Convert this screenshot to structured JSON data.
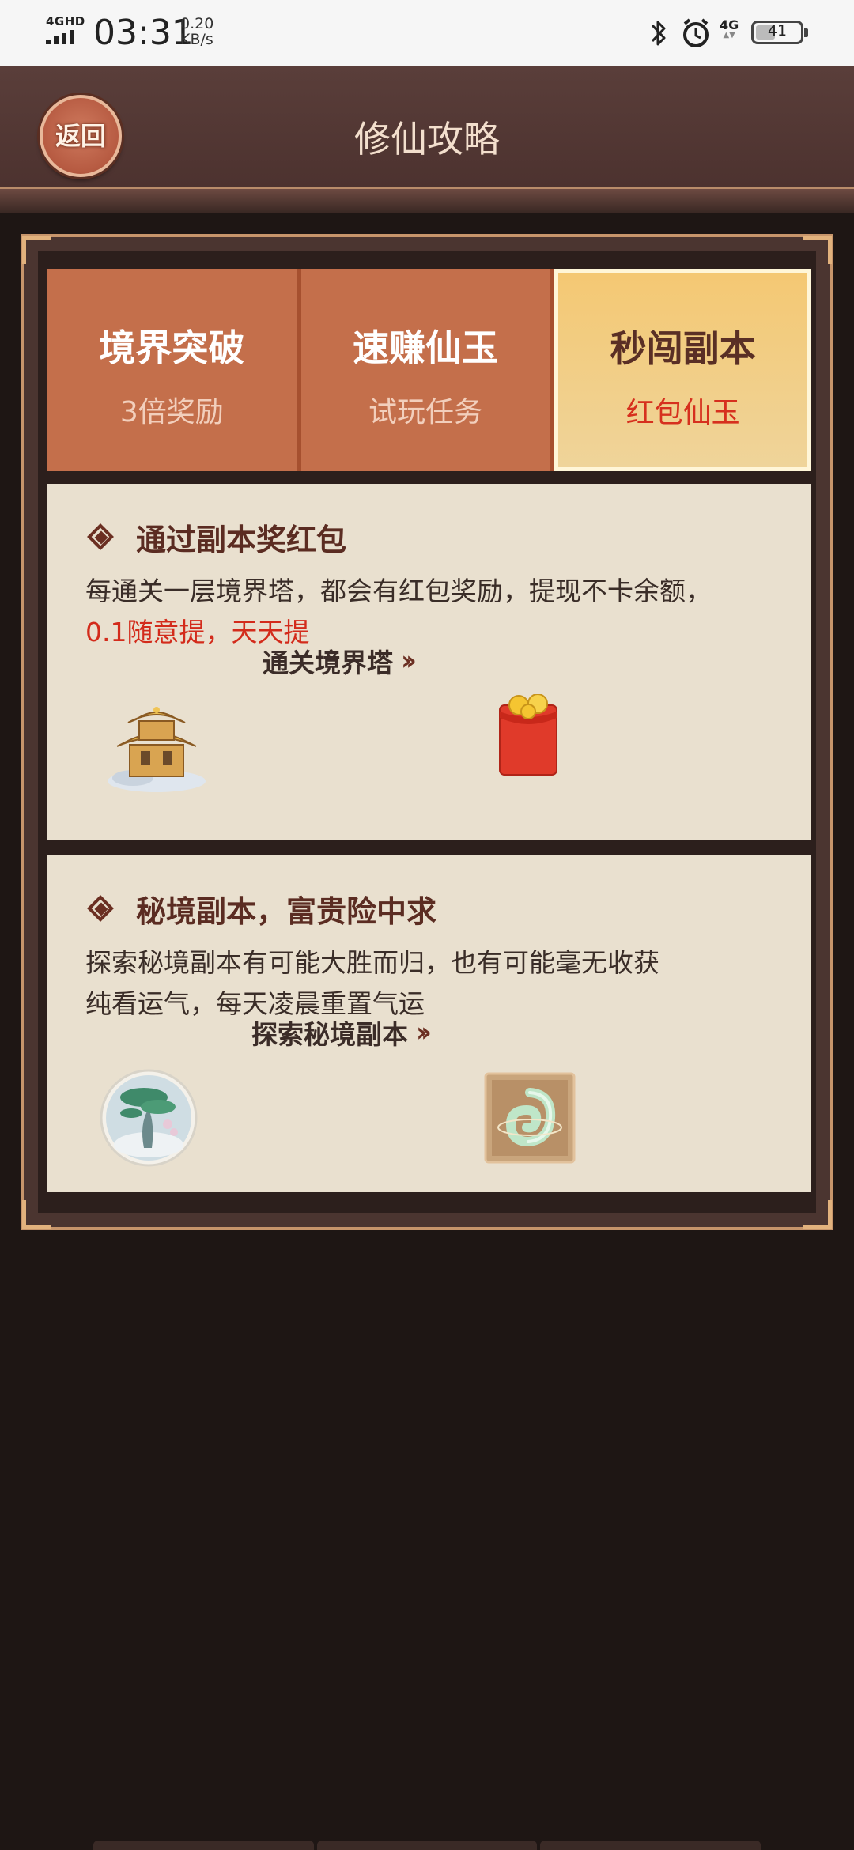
{
  "status_bar": {
    "network": "4GHD",
    "time": "03:31",
    "speed_value": "0.20",
    "speed_unit": "KB/s",
    "cell": "4G",
    "battery": "41"
  },
  "header": {
    "back_label": "返回",
    "title": "修仙攻略"
  },
  "tabs": [
    {
      "title": "境界突破",
      "subtitle": "3倍奖励",
      "active": false
    },
    {
      "title": "速赚仙玉",
      "subtitle": "试玩任务",
      "active": false
    },
    {
      "title": "秒闯副本",
      "subtitle": "红包仙玉",
      "active": true
    }
  ],
  "cards": [
    {
      "title": "通过副本奖红包",
      "desc_line1": "每通关一层境界塔，都会有红包奖励，提现不卡余额，",
      "desc_highlight": "0.1随意提，天天提",
      "link_label": "通关境界塔"
    },
    {
      "title": "秘境副本，富贵险中求",
      "desc_line1": "探索秘境副本有可能大胜而归，也有可能毫无收获",
      "desc_line2": "纯看运气，每天凌晨重置气运",
      "link_label": "探索秘境副本"
    }
  ],
  "colors": {
    "background": "#1e1614",
    "tab": "#c46f4b",
    "tab_active": "#f4c873",
    "card": "#e9e0cf",
    "highlight": "#d32b1b"
  },
  "icons": [
    "signal-icon",
    "bluetooth-icon",
    "alarm-icon",
    "battery-icon",
    "diamond-icon",
    "chevron-double-right-icon",
    "pagoda-icon",
    "red-packet-icon",
    "tree-icon",
    "jade-icon"
  ]
}
